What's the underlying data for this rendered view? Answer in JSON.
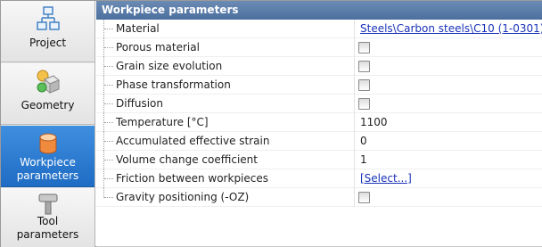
{
  "nav": {
    "items": [
      {
        "label": "Project",
        "icon": "project-tree-icon"
      },
      {
        "label": "Geometry",
        "icon": "geometry-shapes-icon"
      },
      {
        "label": "Workpiece parameters",
        "label_line1": "Workpiece",
        "label_line2": "parameters",
        "icon": "workpiece-cylinder-icon",
        "active": true
      },
      {
        "label": "Tool parameters",
        "label_line1": "Tool",
        "label_line2": "parameters",
        "icon": "tool-icon"
      }
    ]
  },
  "panel": {
    "title": "Workpiece parameters",
    "rows": [
      {
        "name": "Material",
        "value": "Steels\\Carbon steels\\C10 (1-0301)",
        "type": "link"
      },
      {
        "name": "Porous material",
        "type": "checkbox",
        "checked": false
      },
      {
        "name": "Grain size evolution",
        "type": "checkbox",
        "checked": false
      },
      {
        "name": "Phase transformation",
        "type": "checkbox",
        "checked": false
      },
      {
        "name": "Diffusion",
        "type": "checkbox",
        "checked": false
      },
      {
        "name": "Temperature [°C]",
        "value": "1100",
        "type": "text"
      },
      {
        "name": "Accumulated effective strain",
        "value": "0",
        "type": "text"
      },
      {
        "name": "Volume change coefficient",
        "value": "1",
        "type": "text"
      },
      {
        "name": "Friction between workpieces",
        "value": "[Select...]",
        "type": "link"
      },
      {
        "name": "Gravity positioning (-OZ)",
        "type": "checkbox",
        "checked": false
      }
    ]
  },
  "colors": {
    "header": "#5a7aa8",
    "active_nav": "#2f7dd6",
    "link": "#1a32b8"
  }
}
